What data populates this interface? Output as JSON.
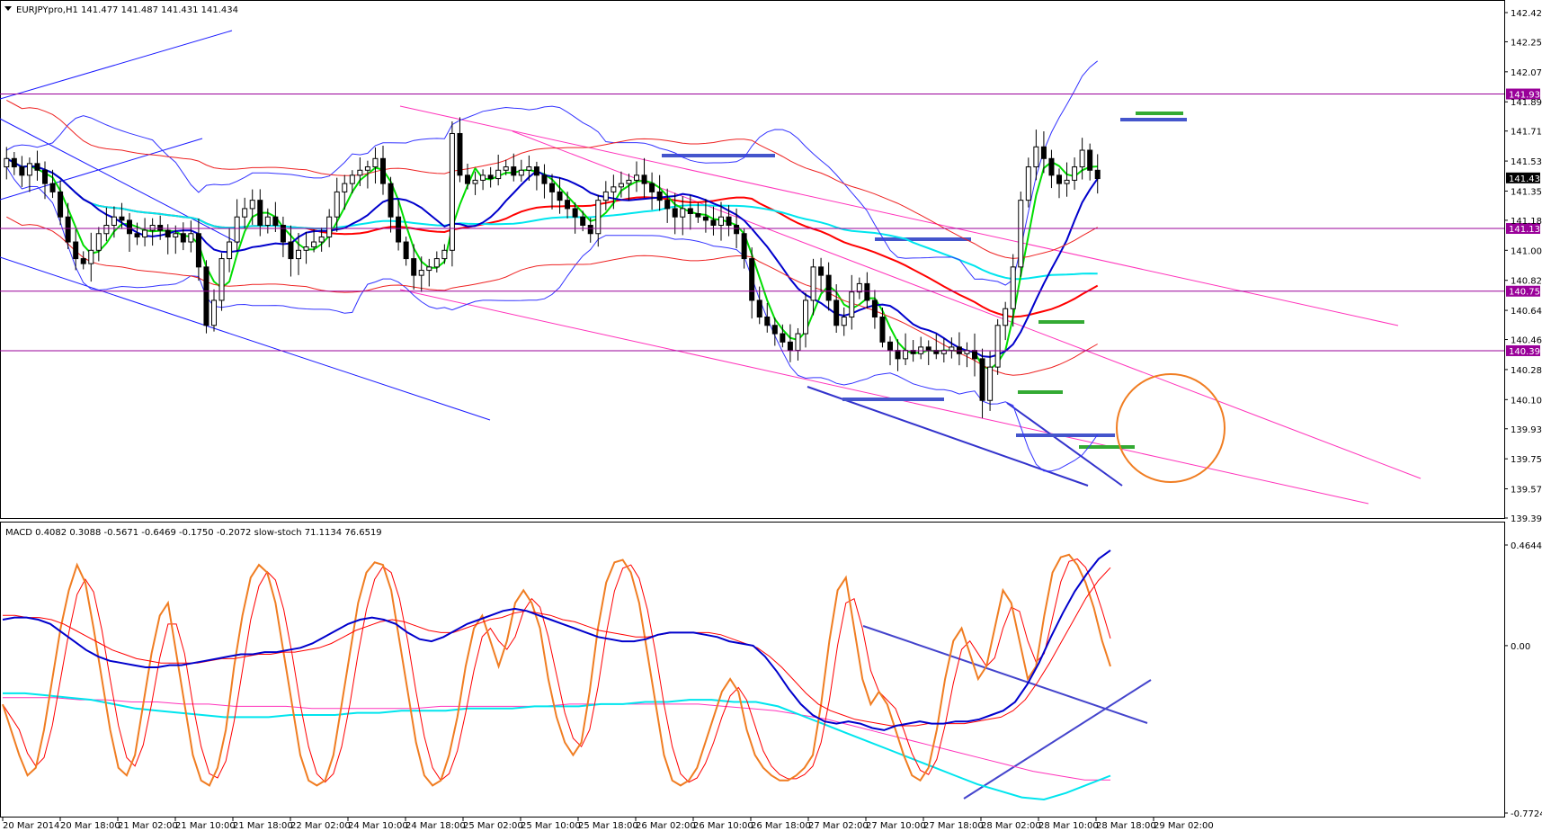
{
  "chart_data": [
    {
      "type": "candlestick",
      "title": "EURJPYpro,H1",
      "ohlc_header": "141.477 141.487 141.431 141.434",
      "ylim": [
        139.395,
        142.425
      ],
      "y_ticks": [
        "142.425",
        "142.250",
        "142.070",
        "141.890",
        "141.715",
        "141.535",
        "141.355",
        "141.180",
        "141.000",
        "140.820",
        "140.640",
        "140.465",
        "140.285",
        "140.105",
        "139.930",
        "139.750",
        "139.570",
        "139.395"
      ],
      "x_ticks": [
        "20 Mar 2014",
        "20 Mar 18:00",
        "21 Mar 02:00",
        "21 Mar 10:00",
        "21 Mar 18:00",
        "22 Mar 02:00",
        "24 Mar 10:00",
        "24 Mar 18:00",
        "25 Mar 02:00",
        "25 Mar 10:00",
        "25 Mar 18:00",
        "26 Mar 02:00",
        "26 Mar 10:00",
        "26 Mar 18:00",
        "27 Mar 02:00",
        "27 Mar 10:00",
        "27 Mar 18:00",
        "28 Mar 02:00",
        "28 Mar 10:00",
        "28 Mar 18:00",
        "29 Mar 02:00"
      ],
      "horizontal_levels": [
        {
          "value": 141.937,
          "label": "141.937"
        },
        {
          "value": 141.131,
          "label": "141.131"
        },
        {
          "value": 140.755,
          "label": "140.755"
        },
        {
          "value": 140.398,
          "label": "140.398"
        }
      ],
      "current_price": {
        "value": 141.434,
        "label": "141.434"
      },
      "close_series": [
        141.55,
        141.5,
        141.45,
        141.52,
        141.48,
        141.4,
        141.35,
        141.2,
        141.05,
        140.95,
        140.92,
        141.0,
        141.1,
        141.15,
        141.2,
        141.18,
        141.1,
        141.08,
        141.12,
        141.15,
        141.12,
        141.08,
        141.1,
        141.05,
        141.1,
        140.9,
        140.55,
        140.7,
        140.95,
        141.05,
        141.2,
        141.25,
        141.3,
        141.15,
        141.2,
        141.15,
        141.05,
        140.95,
        141.0,
        141.02,
        141.05,
        141.08,
        141.2,
        141.35,
        141.4,
        141.45,
        141.48,
        141.5,
        141.55,
        141.4,
        141.2,
        141.05,
        140.95,
        140.85,
        140.88,
        140.9,
        140.95,
        141.0,
        141.7,
        141.45,
        141.4,
        141.42,
        141.45,
        141.43,
        141.48,
        141.5,
        141.45,
        141.48,
        141.5,
        141.45,
        141.4,
        141.35,
        141.3,
        141.25,
        141.2,
        141.15,
        141.1,
        141.3,
        141.35,
        141.38,
        141.4,
        141.42,
        141.45,
        141.4,
        141.35,
        141.3,
        141.25,
        141.2,
        141.25,
        141.22,
        141.2,
        141.18,
        141.15,
        141.2,
        141.15,
        141.1,
        140.95,
        140.7,
        140.6,
        140.55,
        140.5,
        140.45,
        140.4,
        140.5,
        140.7,
        140.9,
        140.85,
        140.7,
        140.55,
        140.6,
        140.75,
        140.8,
        140.7,
        140.6,
        140.45,
        140.4,
        140.35,
        140.4,
        140.38,
        140.42,
        140.4,
        140.38,
        140.4,
        140.42,
        140.38,
        140.4,
        140.35,
        140.1,
        140.3,
        140.55,
        140.65,
        140.9,
        141.3,
        141.5,
        141.62,
        141.55,
        141.45,
        141.4,
        141.42,
        141.5,
        141.6,
        141.48,
        141.43
      ],
      "moving_averages": [
        {
          "color": "#ff0000"
        },
        {
          "color": "#00e5ee"
        },
        {
          "color": "#00dd00"
        },
        {
          "color": "#0000cc"
        }
      ]
    },
    {
      "type": "line",
      "title": "MACD 0.4082 0.3088 -0.5671 -0.6469 -0.1750 -0.2072",
      "indicator2": "slow-stoch 71.1134 76.6519",
      "ylim": [
        -0.7724,
        0.4644
      ],
      "y_ticks": [
        "0.4644",
        "0.00",
        "-0.7724"
      ],
      "stoch_main": [
        40,
        30,
        20,
        12,
        15,
        30,
        50,
        70,
        85,
        95,
        88,
        70,
        50,
        30,
        15,
        12,
        20,
        40,
        60,
        75,
        80,
        60,
        40,
        20,
        10,
        8,
        15,
        30,
        55,
        75,
        90,
        95,
        92,
        80,
        60,
        40,
        20,
        10,
        8,
        10,
        20,
        40,
        60,
        80,
        92,
        96,
        95,
        85,
        65,
        45,
        25,
        12,
        8,
        10,
        20,
        35,
        55,
        70,
        75,
        65,
        55,
        65,
        80,
        85,
        80,
        70,
        50,
        35,
        25,
        20,
        25,
        45,
        70,
        88,
        96,
        97,
        92,
        80,
        60,
        40,
        20,
        10,
        8,
        10,
        15,
        25,
        35,
        45,
        50,
        45,
        30,
        20,
        15,
        12,
        10,
        10,
        12,
        15,
        20,
        40,
        65,
        85,
        90,
        70,
        50,
        40,
        45,
        40,
        30,
        20,
        12,
        10,
        15,
        30,
        50,
        65,
        70,
        60,
        50,
        55,
        70,
        85,
        80,
        65,
        50,
        55,
        75,
        92,
        98,
        99,
        95,
        88,
        78,
        65,
        55
      ],
      "macd_line": [
        0.12,
        0.13,
        0.13,
        0.12,
        0.1,
        0.06,
        0.02,
        -0.02,
        -0.05,
        -0.07,
        -0.08,
        -0.09,
        -0.1,
        -0.1,
        -0.09,
        -0.09,
        -0.08,
        -0.07,
        -0.06,
        -0.05,
        -0.04,
        -0.04,
        -0.03,
        -0.03,
        -0.02,
        -0.01,
        0.01,
        0.04,
        0.07,
        0.1,
        0.12,
        0.13,
        0.12,
        0.1,
        0.06,
        0.03,
        0.02,
        0.04,
        0.07,
        0.1,
        0.12,
        0.14,
        0.16,
        0.17,
        0.16,
        0.14,
        0.12,
        0.1,
        0.08,
        0.06,
        0.04,
        0.03,
        0.02,
        0.02,
        0.03,
        0.05,
        0.06,
        0.06,
        0.06,
        0.05,
        0.04,
        0.02,
        0.01,
        0.0,
        -0.05,
        -0.12,
        -0.2,
        -0.27,
        -0.32,
        -0.35,
        -0.36,
        -0.35,
        -0.36,
        -0.38,
        -0.39,
        -0.37,
        -0.36,
        -0.35,
        -0.36,
        -0.36,
        -0.35,
        -0.35,
        -0.34,
        -0.32,
        -0.3,
        -0.26,
        -0.18,
        -0.08,
        0.04,
        0.15,
        0.25,
        0.33,
        0.4,
        0.44
      ],
      "signal_line": [
        0.14,
        0.14,
        0.13,
        0.13,
        0.12,
        0.1,
        0.07,
        0.04,
        0.01,
        -0.02,
        -0.04,
        -0.06,
        -0.07,
        -0.08,
        -0.08,
        -0.08,
        -0.08,
        -0.07,
        -0.06,
        -0.06,
        -0.05,
        -0.04,
        -0.04,
        -0.03,
        -0.03,
        -0.02,
        -0.01,
        0.01,
        0.04,
        0.07,
        0.09,
        0.11,
        0.12,
        0.11,
        0.09,
        0.07,
        0.06,
        0.06,
        0.08,
        0.1,
        0.12,
        0.13,
        0.15,
        0.16,
        0.15,
        0.14,
        0.12,
        0.11,
        0.09,
        0.07,
        0.06,
        0.05,
        0.04,
        0.04,
        0.05,
        0.06,
        0.06,
        0.06,
        0.06,
        0.05,
        0.03,
        0.01,
        -0.01,
        -0.05,
        -0.1,
        -0.16,
        -0.22,
        -0.27,
        -0.3,
        -0.32,
        -0.34,
        -0.35,
        -0.36,
        -0.37,
        -0.37,
        -0.37,
        -0.36,
        -0.36,
        -0.36,
        -0.36,
        -0.35,
        -0.34,
        -0.33,
        -0.3,
        -0.25,
        -0.17,
        -0.08,
        0.02,
        0.12,
        0.22,
        0.3,
        0.36
      ],
      "cyan_line": [
        -0.22,
        -0.22,
        -0.23,
        -0.24,
        -0.25,
        -0.27,
        -0.29,
        -0.3,
        -0.31,
        -0.32,
        -0.33,
        -0.33,
        -0.33,
        -0.32,
        -0.32,
        -0.32,
        -0.31,
        -0.31,
        -0.3,
        -0.3,
        -0.3,
        -0.29,
        -0.29,
        -0.29,
        -0.28,
        -0.28,
        -0.28,
        -0.27,
        -0.27,
        -0.26,
        -0.26,
        -0.25,
        -0.25,
        -0.26,
        -0.26,
        -0.28,
        -0.32,
        -0.36,
        -0.4,
        -0.44,
        -0.48,
        -0.52,
        -0.56,
        -0.6,
        -0.64,
        -0.67,
        -0.7,
        -0.71,
        -0.68,
        -0.64,
        -0.6
      ],
      "pink_line": [
        -0.24,
        -0.24,
        -0.24,
        -0.25,
        -0.25,
        -0.26,
        -0.26,
        -0.27,
        -0.27,
        -0.28,
        -0.28,
        -0.28,
        -0.29,
        -0.29,
        -0.29,
        -0.29,
        -0.29,
        -0.28,
        -0.28,
        -0.28,
        -0.28,
        -0.28,
        -0.27,
        -0.27,
        -0.27,
        -0.27,
        -0.27,
        -0.27,
        -0.28,
        -0.29,
        -0.3,
        -0.32,
        -0.34,
        -0.37,
        -0.4,
        -0.43,
        -0.46,
        -0.49,
        -0.52,
        -0.55,
        -0.58,
        -0.6,
        -0.62,
        -0.62
      ]
    }
  ]
}
